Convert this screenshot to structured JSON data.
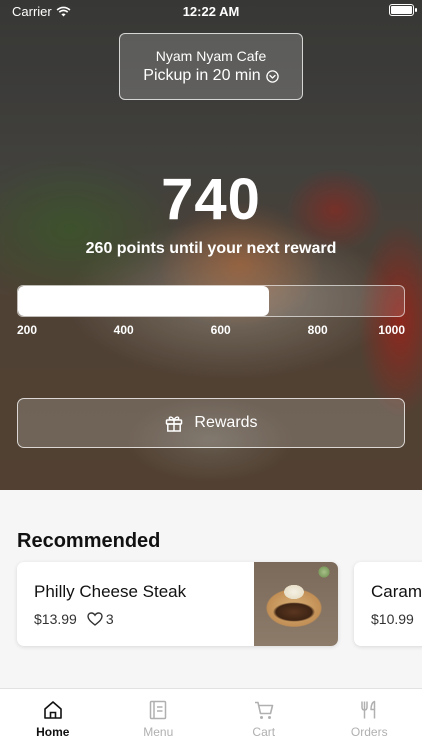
{
  "status_bar": {
    "carrier": "Carrier",
    "time": "12:22 AM"
  },
  "store": {
    "name": "Nyam Nyam Cafe",
    "pickup": "Pickup in 20 min"
  },
  "rewards": {
    "points": "740",
    "subtitle": "260 points until your next reward",
    "progress_fraction": 0.65,
    "scale_labels": [
      "200",
      "400",
      "600",
      "800",
      "1000"
    ],
    "button_label": "Rewards"
  },
  "recommended": {
    "title": "Recommended",
    "items": [
      {
        "name": "Philly Cheese Steak",
        "price": "$13.99",
        "likes": "3"
      },
      {
        "name": "Caram",
        "price": "$10.99"
      }
    ]
  },
  "tabs": [
    {
      "label": "Home",
      "icon": "home-icon",
      "active": true
    },
    {
      "label": "Menu",
      "icon": "menu-icon",
      "active": false
    },
    {
      "label": "Cart",
      "icon": "cart-icon",
      "active": false
    },
    {
      "label": "Orders",
      "icon": "orders-icon",
      "active": false
    }
  ]
}
